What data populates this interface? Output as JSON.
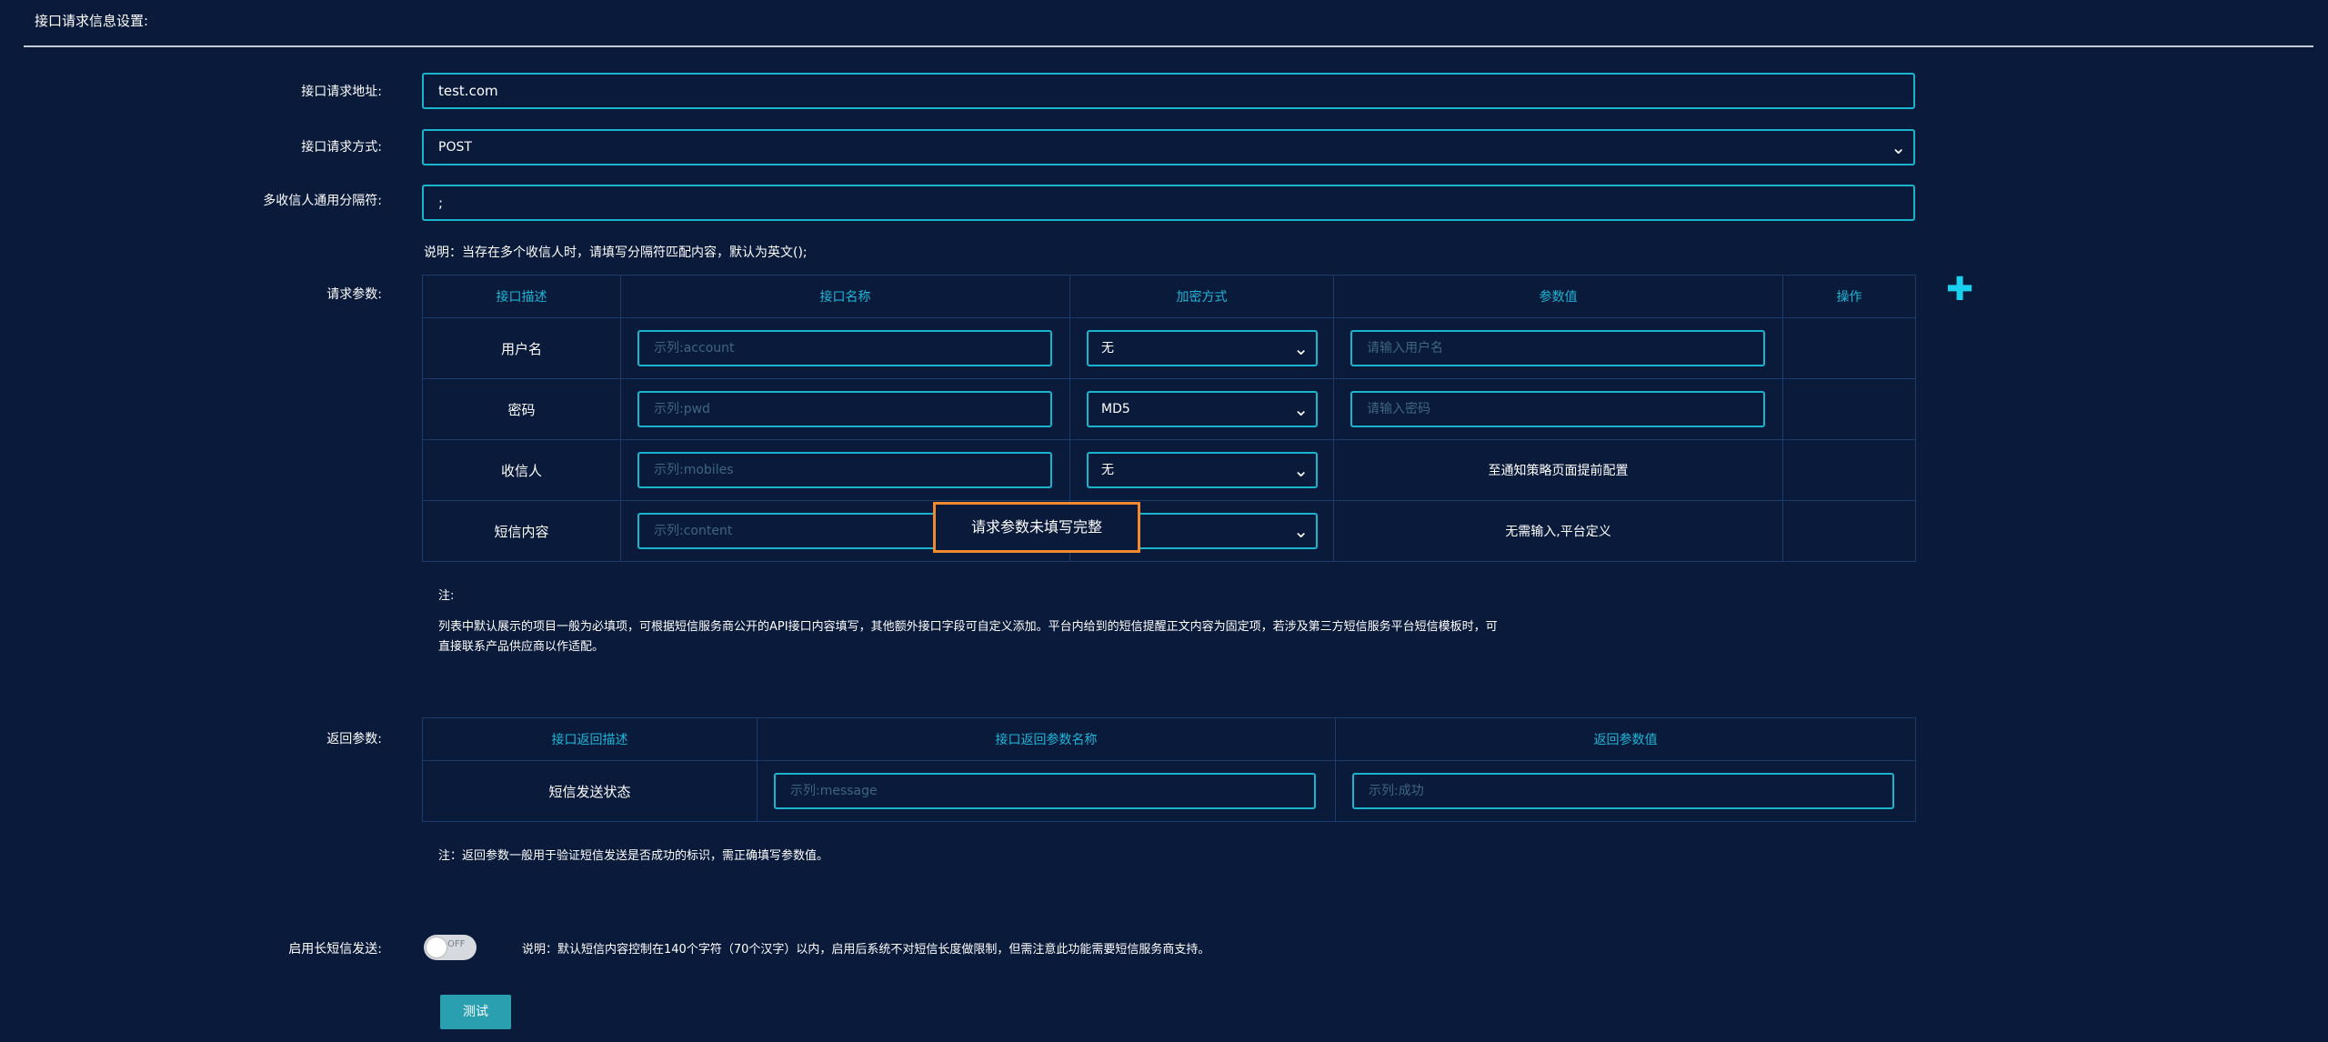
{
  "header": {
    "title": "接口请求信息设置:"
  },
  "form": {
    "url": {
      "label": "接口请求地址:",
      "value": "test.com"
    },
    "method": {
      "label": "接口请求方式:",
      "value": "POST"
    },
    "separator": {
      "label": "多收信人通用分隔符:",
      "value": ";"
    },
    "separator_hint": "说明：当存在多个收信人时，请填写分隔符匹配内容，默认为英文();"
  },
  "request_params": {
    "label": "请求参数:",
    "headers": [
      "接口描述",
      "接口名称",
      "加密方式",
      "参数值",
      "操作"
    ],
    "rows": [
      {
        "desc": "用户名",
        "name_placeholder": "示列:account",
        "encrypt": "无",
        "value_placeholder": "请输入用户名",
        "value_text": ""
      },
      {
        "desc": "密码",
        "name_placeholder": "示列:pwd",
        "encrypt": "MD5",
        "value_placeholder": "请输入密码",
        "value_text": ""
      },
      {
        "desc": "收信人",
        "name_placeholder": "示列:mobiles",
        "encrypt": "无",
        "value_placeholder": "",
        "value_text": "至通知策略页面提前配置"
      },
      {
        "desc": "短信内容",
        "name_placeholder": "示列:content",
        "encrypt": "",
        "value_placeholder": "",
        "value_text": "无需输入,平台定义"
      }
    ],
    "add_icon": "plus-icon"
  },
  "toast": {
    "message": "请求参数未填写完整"
  },
  "request_note": {
    "title": "注:",
    "line1": "列表中默认展示的项目一般为必填项，可根据短信服务商公开的API接口内容填写，其他额外接口字段可自定义添加。平台内给到的短信提醒正文内容为固定项，若涉及第三方短信服务平台短信模板时，可",
    "line2": "直接联系产品供应商以作适配。"
  },
  "response_params": {
    "label": "返回参数:",
    "headers": [
      "接口返回描述",
      "接口返回参数名称",
      "返回参数值"
    ],
    "row": {
      "desc": "短信发送状态",
      "name_placeholder": "示列:message",
      "value_placeholder": "示列:成功"
    },
    "note": "注：返回参数一般用于验证短信发送是否成功的标识，需正确填写参数值。"
  },
  "long_sms": {
    "label": "启用长短信发送:",
    "toggle_text": "OFF",
    "hint": "说明：默认短信内容控制在140个字符（70个汉字）以内，启用后系统不对短信长度做限制，但需注意此功能需要短信服务商支持。"
  },
  "test_button": {
    "label": "测试"
  }
}
